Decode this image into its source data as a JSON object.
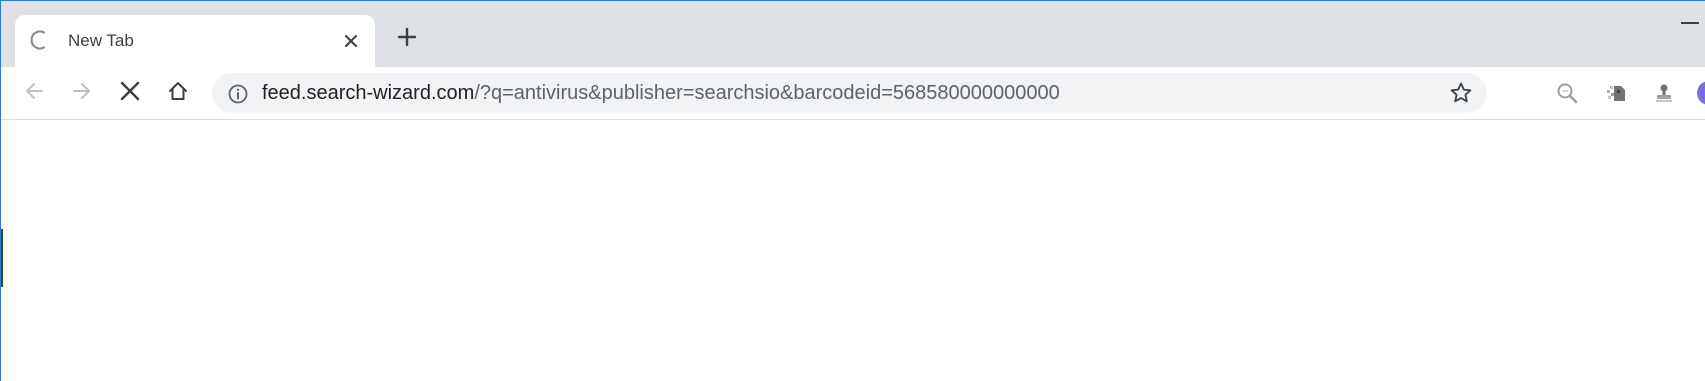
{
  "tab": {
    "title": "New Tab"
  },
  "omnibox": {
    "host": "feed.search-wizard.com",
    "path": "/?q=antivirus&publisher=searchsio&barcodeid=568580000000000"
  },
  "colors": {
    "tabstrip_bg": "#dee1e6",
    "omnibox_bg": "#f1f3f4",
    "text_primary": "#202124",
    "text_secondary": "#5f6368",
    "avatar": "#7b6fe0"
  },
  "icons": [
    "loading-spinner-icon",
    "close-icon",
    "plus-icon",
    "back-arrow-icon",
    "forward-arrow-icon",
    "stop-icon",
    "home-icon",
    "info-icon",
    "star-icon",
    "search-extension-icon",
    "pixel-extension-icon",
    "stamp-extension-icon",
    "avatar"
  ]
}
